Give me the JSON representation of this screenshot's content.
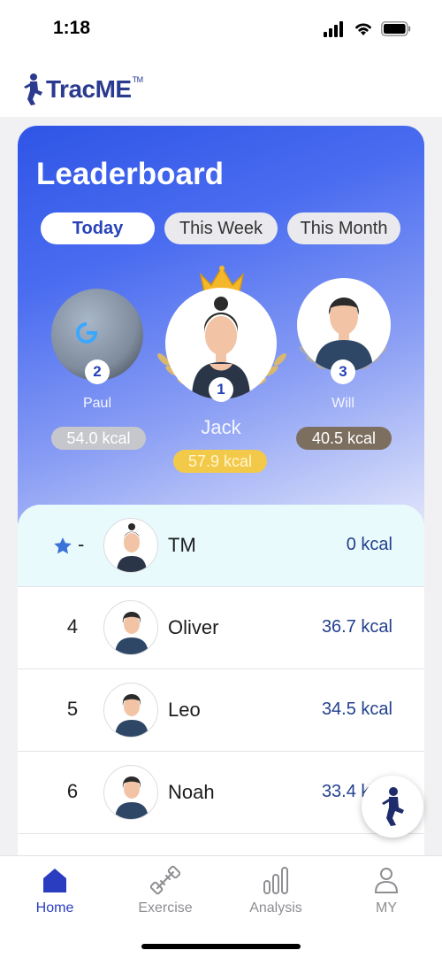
{
  "status_bar": {
    "time": "1:18"
  },
  "app": {
    "logo_text": "TracME",
    "logo_tm": "TM"
  },
  "leaderboard": {
    "title": "Leaderboard",
    "tabs": [
      {
        "label": "Today",
        "active": true
      },
      {
        "label": "This Week",
        "active": false
      },
      {
        "label": "This Month",
        "active": false
      }
    ],
    "podium": [
      {
        "rank": "2",
        "name": "Paul",
        "kcal": "54.0 kcal",
        "pill_color": "#c6c7cc"
      },
      {
        "rank": "1",
        "name": "Jack",
        "kcal": "57.9 kcal",
        "pill_color": "#f3c94a"
      },
      {
        "rank": "3",
        "name": "Will",
        "kcal": "40.5 kcal",
        "pill_color": "#7d6f5f"
      }
    ],
    "rows": [
      {
        "rank": "-",
        "name": "TM",
        "kcal": "0 kcal",
        "is_current_user": true,
        "icon": "star-icon"
      },
      {
        "rank": "4",
        "name": "Oliver",
        "kcal": "36.7 kcal"
      },
      {
        "rank": "5",
        "name": "Leo",
        "kcal": "34.5 kcal"
      },
      {
        "rank": "6",
        "name": "Noah",
        "kcal": "33.4 kcal"
      }
    ]
  },
  "nav": [
    {
      "label": "Home",
      "icon": "home-icon",
      "active": true
    },
    {
      "label": "Exercise",
      "icon": "dumbbell-icon",
      "active": false
    },
    {
      "label": "Analysis",
      "icon": "bar-chart-icon",
      "active": false
    },
    {
      "label": "MY",
      "icon": "person-icon",
      "active": false
    }
  ],
  "colors": {
    "accent": "#2742b8",
    "kcal_text": "#23408e",
    "current_row": "#e9fafc"
  }
}
